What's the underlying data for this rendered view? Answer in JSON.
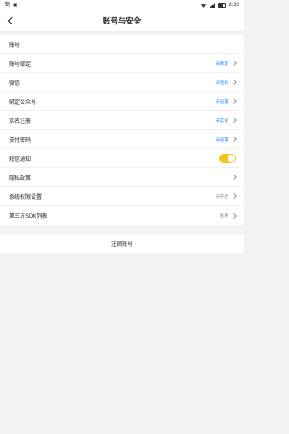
{
  "status_bar": {
    "left_icons": [
      "sim-icon",
      "app-notification-icon"
    ],
    "time": "3:32"
  },
  "header": {
    "title": "账号与安全"
  },
  "rows": [
    {
      "label": "账号",
      "value": ""
    },
    {
      "label": "账号绑定",
      "value": "未绑定"
    },
    {
      "label": "微信",
      "value": "去授权"
    },
    {
      "label": "绑定公众号",
      "value": "去设置"
    },
    {
      "label": "实名注册",
      "value": "未实名"
    },
    {
      "label": "支付密码",
      "value": "未设置"
    },
    {
      "label": "短信通知",
      "toggle_on": true
    },
    {
      "label": "隐私政策",
      "value": ""
    },
    {
      "label": "系统权限设置",
      "value": "去开启"
    },
    {
      "label": "第三方SDK列表",
      "value": "查看"
    }
  ],
  "cancel_account_label": "注销账号"
}
